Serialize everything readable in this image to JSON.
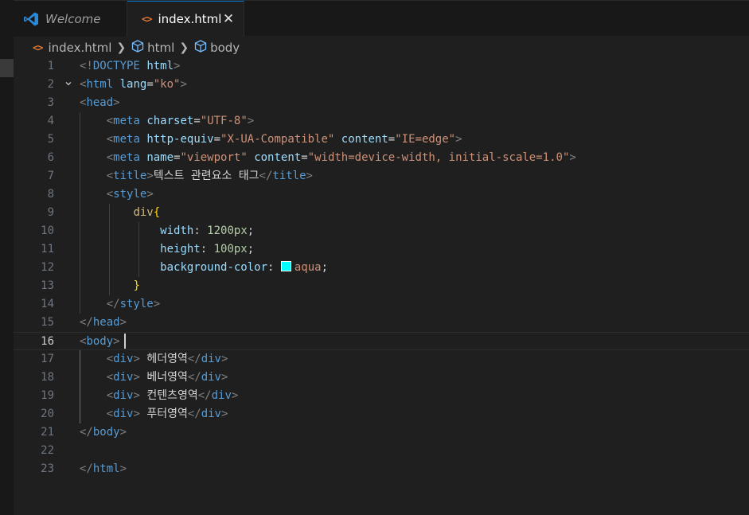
{
  "tabs": [
    {
      "label": "Welcome",
      "icon": "vscode-logo-icon",
      "active": false
    },
    {
      "label": "index.html",
      "icon": "html-file-icon",
      "active": true
    }
  ],
  "breadcrumb": [
    {
      "label": "index.html",
      "icon": "html-file-icon"
    },
    {
      "label": "html",
      "icon": "cube-icon"
    },
    {
      "label": "body",
      "icon": "cube-icon"
    }
  ],
  "editor": {
    "active_line": 16,
    "swatch_color": "#00ffff",
    "lines": [
      {
        "n": "1",
        "fold": "",
        "segments": [
          [
            "tag-br",
            "<!"
          ],
          [
            "tag",
            "DOCTYPE"
          ],
          [
            "txt",
            " "
          ],
          [
            "attr",
            "html"
          ],
          [
            "tag-br",
            ">"
          ]
        ]
      },
      {
        "n": "2",
        "fold": "v",
        "segments": [
          [
            "tag-br",
            "<"
          ],
          [
            "tag",
            "html"
          ],
          [
            "txt",
            " "
          ],
          [
            "attr",
            "lang"
          ],
          [
            "txt",
            "="
          ],
          [
            "str",
            "\"ko\""
          ],
          [
            "tag-br",
            ">"
          ]
        ]
      },
      {
        "n": "3",
        "fold": "",
        "segments": [
          [
            "tag-br",
            "<"
          ],
          [
            "tag",
            "head"
          ],
          [
            "tag-br",
            ">"
          ]
        ]
      },
      {
        "n": "4",
        "fold": "",
        "segments": [
          [
            "txt",
            "    "
          ],
          [
            "tag-br",
            "<"
          ],
          [
            "tag",
            "meta"
          ],
          [
            "txt",
            " "
          ],
          [
            "attr",
            "charset"
          ],
          [
            "txt",
            "="
          ],
          [
            "str",
            "\"UTF-8\""
          ],
          [
            "tag-br",
            ">"
          ]
        ]
      },
      {
        "n": "5",
        "fold": "",
        "segments": [
          [
            "txt",
            "    "
          ],
          [
            "tag-br",
            "<"
          ],
          [
            "tag",
            "meta"
          ],
          [
            "txt",
            " "
          ],
          [
            "attr",
            "http-equiv"
          ],
          [
            "txt",
            "="
          ],
          [
            "str",
            "\"X-UA-Compatible\""
          ],
          [
            "txt",
            " "
          ],
          [
            "attr",
            "content"
          ],
          [
            "txt",
            "="
          ],
          [
            "str",
            "\"IE=edge\""
          ],
          [
            "tag-br",
            ">"
          ]
        ]
      },
      {
        "n": "6",
        "fold": "",
        "segments": [
          [
            "txt",
            "    "
          ],
          [
            "tag-br",
            "<"
          ],
          [
            "tag",
            "meta"
          ],
          [
            "txt",
            " "
          ],
          [
            "attr",
            "name"
          ],
          [
            "txt",
            "="
          ],
          [
            "str",
            "\"viewport\""
          ],
          [
            "txt",
            " "
          ],
          [
            "attr",
            "content"
          ],
          [
            "txt",
            "="
          ],
          [
            "str",
            "\"width=device-width, initial-scale=1.0\""
          ],
          [
            "tag-br",
            ">"
          ]
        ]
      },
      {
        "n": "7",
        "fold": "",
        "segments": [
          [
            "txt",
            "    "
          ],
          [
            "tag-br",
            "<"
          ],
          [
            "tag",
            "title"
          ],
          [
            "tag-br",
            ">"
          ],
          [
            "txt",
            "텍스트 관련요소 태그"
          ],
          [
            "tag-br",
            "</"
          ],
          [
            "tag",
            "title"
          ],
          [
            "tag-br",
            ">"
          ]
        ]
      },
      {
        "n": "8",
        "fold": "",
        "segments": [
          [
            "txt",
            "    "
          ],
          [
            "tag-br",
            "<"
          ],
          [
            "tag",
            "style"
          ],
          [
            "tag-br",
            ">"
          ]
        ]
      },
      {
        "n": "9",
        "fold": "",
        "segments": [
          [
            "txt",
            "        "
          ],
          [
            "sel",
            "div"
          ],
          [
            "brace",
            "{"
          ]
        ]
      },
      {
        "n": "10",
        "fold": "",
        "segments": [
          [
            "txt",
            "            "
          ],
          [
            "prop",
            "width"
          ],
          [
            "txt",
            ": "
          ],
          [
            "num",
            "1200px"
          ],
          [
            "txt",
            ";"
          ]
        ]
      },
      {
        "n": "11",
        "fold": "",
        "segments": [
          [
            "txt",
            "            "
          ],
          [
            "prop",
            "height"
          ],
          [
            "txt",
            ": "
          ],
          [
            "num",
            "100px"
          ],
          [
            "txt",
            ";"
          ]
        ]
      },
      {
        "n": "12",
        "fold": "",
        "segments": [
          [
            "txt",
            "            "
          ],
          [
            "prop",
            "background-color"
          ],
          [
            "txt",
            ": "
          ],
          [
            "swatch",
            ""
          ],
          [
            "val",
            "aqua"
          ],
          [
            "txt",
            ";"
          ]
        ]
      },
      {
        "n": "13",
        "fold": "",
        "segments": [
          [
            "txt",
            "        "
          ],
          [
            "brace",
            "}"
          ]
        ]
      },
      {
        "n": "14",
        "fold": "",
        "segments": [
          [
            "txt",
            "    "
          ],
          [
            "tag-br",
            "</"
          ],
          [
            "tag",
            "style"
          ],
          [
            "tag-br",
            ">"
          ]
        ]
      },
      {
        "n": "15",
        "fold": "",
        "segments": [
          [
            "tag-br",
            "</"
          ],
          [
            "tag",
            "head"
          ],
          [
            "tag-br",
            ">"
          ]
        ]
      },
      {
        "n": "16",
        "fold": "",
        "segments": [
          [
            "tag-br",
            "<"
          ],
          [
            "tag",
            "body"
          ],
          [
            "tag-br",
            ">"
          ]
        ]
      },
      {
        "n": "17",
        "fold": "",
        "segments": [
          [
            "txt",
            "    "
          ],
          [
            "tag-br",
            "<"
          ],
          [
            "tag",
            "div"
          ],
          [
            "tag-br",
            ">"
          ],
          [
            "txt",
            " 헤더영역"
          ],
          [
            "tag-br",
            "</"
          ],
          [
            "tag",
            "div"
          ],
          [
            "tag-br",
            ">"
          ]
        ]
      },
      {
        "n": "18",
        "fold": "",
        "segments": [
          [
            "txt",
            "    "
          ],
          [
            "tag-br",
            "<"
          ],
          [
            "tag",
            "div"
          ],
          [
            "tag-br",
            ">"
          ],
          [
            "txt",
            " 베너영역"
          ],
          [
            "tag-br",
            "</"
          ],
          [
            "tag",
            "div"
          ],
          [
            "tag-br",
            ">"
          ]
        ]
      },
      {
        "n": "19",
        "fold": "",
        "segments": [
          [
            "txt",
            "    "
          ],
          [
            "tag-br",
            "<"
          ],
          [
            "tag",
            "div"
          ],
          [
            "tag-br",
            ">"
          ],
          [
            "txt",
            " 컨텐츠영역"
          ],
          [
            "tag-br",
            "</"
          ],
          [
            "tag",
            "div"
          ],
          [
            "tag-br",
            ">"
          ]
        ]
      },
      {
        "n": "20",
        "fold": "",
        "segments": [
          [
            "txt",
            "    "
          ],
          [
            "tag-br",
            "<"
          ],
          [
            "tag",
            "div"
          ],
          [
            "tag-br",
            ">"
          ],
          [
            "txt",
            " 푸터영역"
          ],
          [
            "tag-br",
            "</"
          ],
          [
            "tag",
            "div"
          ],
          [
            "tag-br",
            ">"
          ]
        ]
      },
      {
        "n": "21",
        "fold": "",
        "segments": [
          [
            "tag-br",
            "</"
          ],
          [
            "tag",
            "body"
          ],
          [
            "tag-br",
            ">"
          ]
        ]
      },
      {
        "n": "22",
        "fold": "",
        "segments": []
      },
      {
        "n": "23",
        "fold": "",
        "segments": [
          [
            "tag-br",
            "</"
          ],
          [
            "tag",
            "html"
          ],
          [
            "tag-br",
            ">"
          ]
        ]
      }
    ]
  }
}
